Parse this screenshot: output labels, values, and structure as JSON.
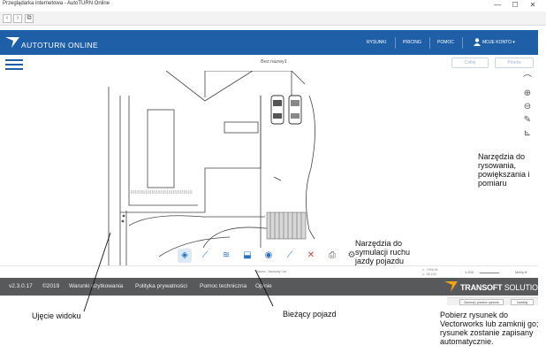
{
  "browser": {
    "title": "Przeglądarka internetowa - AutoTURN Online",
    "controls": {
      "minimize": "—",
      "maximize": "☐",
      "close": "✕"
    },
    "nav": {
      "back": "‹",
      "forward": "›",
      "new_tab": "⧉"
    }
  },
  "header": {
    "logo": "AUTOTURN ONLINE",
    "nav": [
      "RYSUNKI",
      "PRICING",
      "POMOC",
      "MOJE KONTO ▾"
    ]
  },
  "toolbar": {
    "menu_icon": "hamburger-icon",
    "drawing_title": "Bez nazwy1",
    "button_left": "Cofnij",
    "button_right": "Ponów"
  },
  "right_tools": {
    "icons": [
      "arc-icon",
      "zoom-in-icon",
      "zoom-out-icon",
      "pencil-icon",
      "measure-icon"
    ],
    "glyphs": [
      "⌒",
      "⊕",
      "⊖",
      "✎",
      "⊾"
    ]
  },
  "vehicle_toolbar": {
    "icons": [
      "vehicle-icon",
      "steer-icon",
      "path-icon",
      "park-icon",
      "simulate-icon",
      "edit-icon",
      "delete-icon",
      "print-icon",
      "settings-icon"
    ],
    "glyphs": [
      "◈",
      "⟋",
      "≋",
      "⬓",
      "◉",
      "⟋",
      "✕",
      "⎙",
      "⚙"
    ]
  },
  "status": {
    "current_vehicle": "Samoc. Osobowy Car",
    "coord_x": "x: -7996.95",
    "coord_y": "y: -96.100",
    "scale": "1:200",
    "units": "Metry ▾"
  },
  "footer": {
    "version": "v2.3.0.17",
    "copyright": "©2019",
    "links": [
      "Warunki użytkowania",
      "Polityka prywatności",
      "Pomoc techniczna",
      "Opinie"
    ],
    "brand": "TRANSOFT",
    "brand_suffix": "SOLUTIONS"
  },
  "subbar": {
    "left_button": "Zamknij i pobierz rysunek",
    "right_button": "Zamknij"
  },
  "callouts": {
    "drawing_tools": "Narzędzia do rysowania, powiększania i pomiaru",
    "vehicle_tools": "Narzędzia do symulacji ruchu jazdy pojazdu",
    "viewport": "Ujęcie widoku",
    "current_vehicle": "Bieżący pojazd",
    "download_note": "Pobierz rysunek do Vectorworks lub zamknij go; rysunek zostanie zapisany automatycznie."
  },
  "colors": {
    "header": "#1f5fa8",
    "footer": "#58595b",
    "accent": "#2a6fbd",
    "logo_orange": "#f0a21a"
  }
}
